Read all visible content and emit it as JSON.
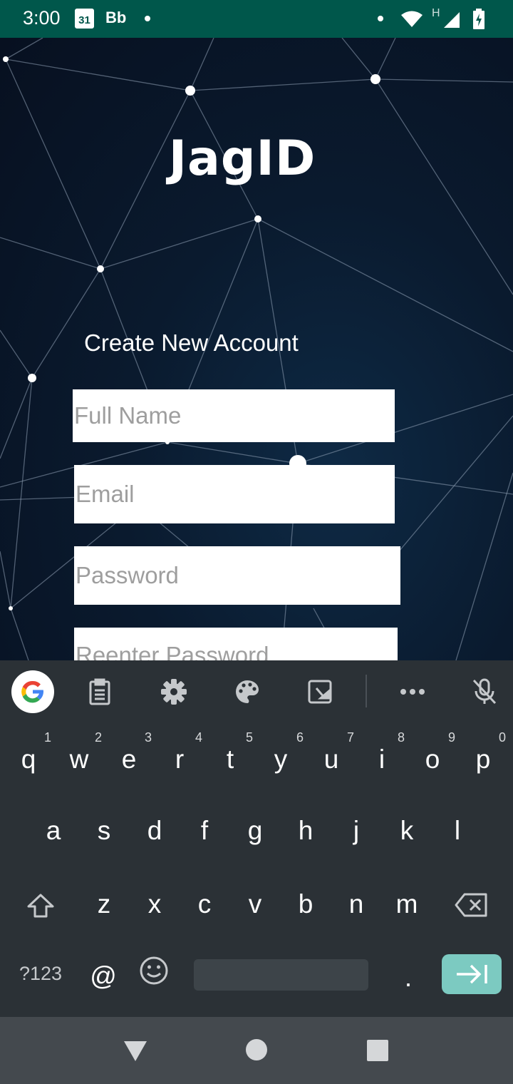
{
  "status_bar": {
    "time": "3:00",
    "calendar_day": "31",
    "notification_label": "Bb",
    "network_label": "H"
  },
  "app": {
    "logo": "JagID",
    "heading": "Create New Account",
    "fields": {
      "full_name_placeholder": "Full Name",
      "email_placeholder": "Email",
      "password_placeholder": "Password",
      "reenter_password_placeholder": "Reenter Password"
    }
  },
  "keyboard": {
    "toolbar_icons": [
      "google-icon",
      "clipboard-icon",
      "settings-icon",
      "palette-icon",
      "screenshot-icon",
      "more-icon",
      "mic-off-icon"
    ],
    "row1": [
      {
        "key": "q",
        "num": "1"
      },
      {
        "key": "w",
        "num": "2"
      },
      {
        "key": "e",
        "num": "3"
      },
      {
        "key": "r",
        "num": "4"
      },
      {
        "key": "t",
        "num": "5"
      },
      {
        "key": "y",
        "num": "6"
      },
      {
        "key": "u",
        "num": "7"
      },
      {
        "key": "i",
        "num": "8"
      },
      {
        "key": "o",
        "num": "9"
      },
      {
        "key": "p",
        "num": "0"
      }
    ],
    "row2": [
      "a",
      "s",
      "d",
      "f",
      "g",
      "h",
      "j",
      "k",
      "l"
    ],
    "row3": [
      "z",
      "x",
      "c",
      "v",
      "b",
      "n",
      "m"
    ],
    "symbols_label": "?123",
    "at_label": "@",
    "period_label": "."
  },
  "colors": {
    "status_bar": "#00574b",
    "keyboard_bg": "#2b3136",
    "enter_key": "#7ccac1",
    "navbar": "#44494e"
  }
}
